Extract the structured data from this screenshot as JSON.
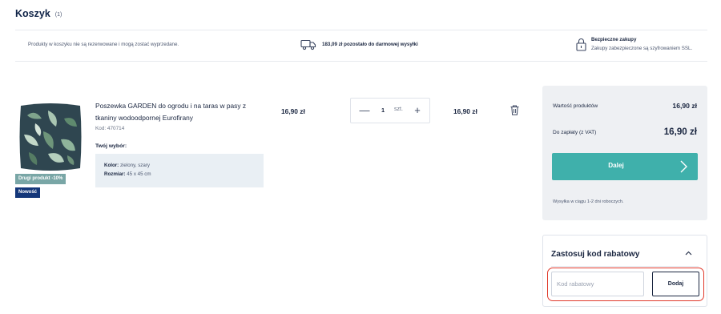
{
  "cart": {
    "title": "Koszyk",
    "count": "(1)"
  },
  "info": {
    "reserved_note": "Produkty w koszyku nie są rezerwowane i mogą zostać wyprzedane.",
    "free_shipping": "183,09 zł pozostało do darmowej wysyłki",
    "secure_title": "Bezpieczne zakupy",
    "secure_sub": "Zakupy zabezpieczone są szyfrowaniem SSL."
  },
  "product": {
    "name": "Poszewka GARDEN do ogrodu i na taras w pasy z tkaniny wodoodpornej Eurofirany",
    "code": "Kod: 470714",
    "badge_promo": "Drugi produkt -10%",
    "badge_new": "Nowość",
    "choice_title": "Twój wybór:",
    "color_label": "Kolor:",
    "color_value": "zielony, szary",
    "size_label": "Rozmiar:",
    "size_value": "45 x 45 cm",
    "unit_price": "16,90 zł",
    "quantity": "1",
    "quantity_unit": "szt.",
    "minus": "—",
    "plus": "+",
    "line_total": "16,90 zł",
    "image_icon": "cushion-image",
    "delete_icon": "trash-icon"
  },
  "summary": {
    "products_value_label": "Wartość produktów",
    "products_value": "16,90 zł",
    "to_pay_label": "Do zapłaty (z VAT)",
    "to_pay": "16,90 zł",
    "next_label": "Dalej",
    "shipping_note": "Wysyłka w ciągu 1-2 dni roboczych."
  },
  "coupon": {
    "title": "Zastosuj kod rabatowy",
    "placeholder": "Kod rabatowy",
    "value": "",
    "button_label": "Dodaj"
  },
  "colors": {
    "accent": "#3fb0ab",
    "navy": "#14377a",
    "promo_badge": "#79a6a6",
    "highlight": "#e0392b"
  }
}
